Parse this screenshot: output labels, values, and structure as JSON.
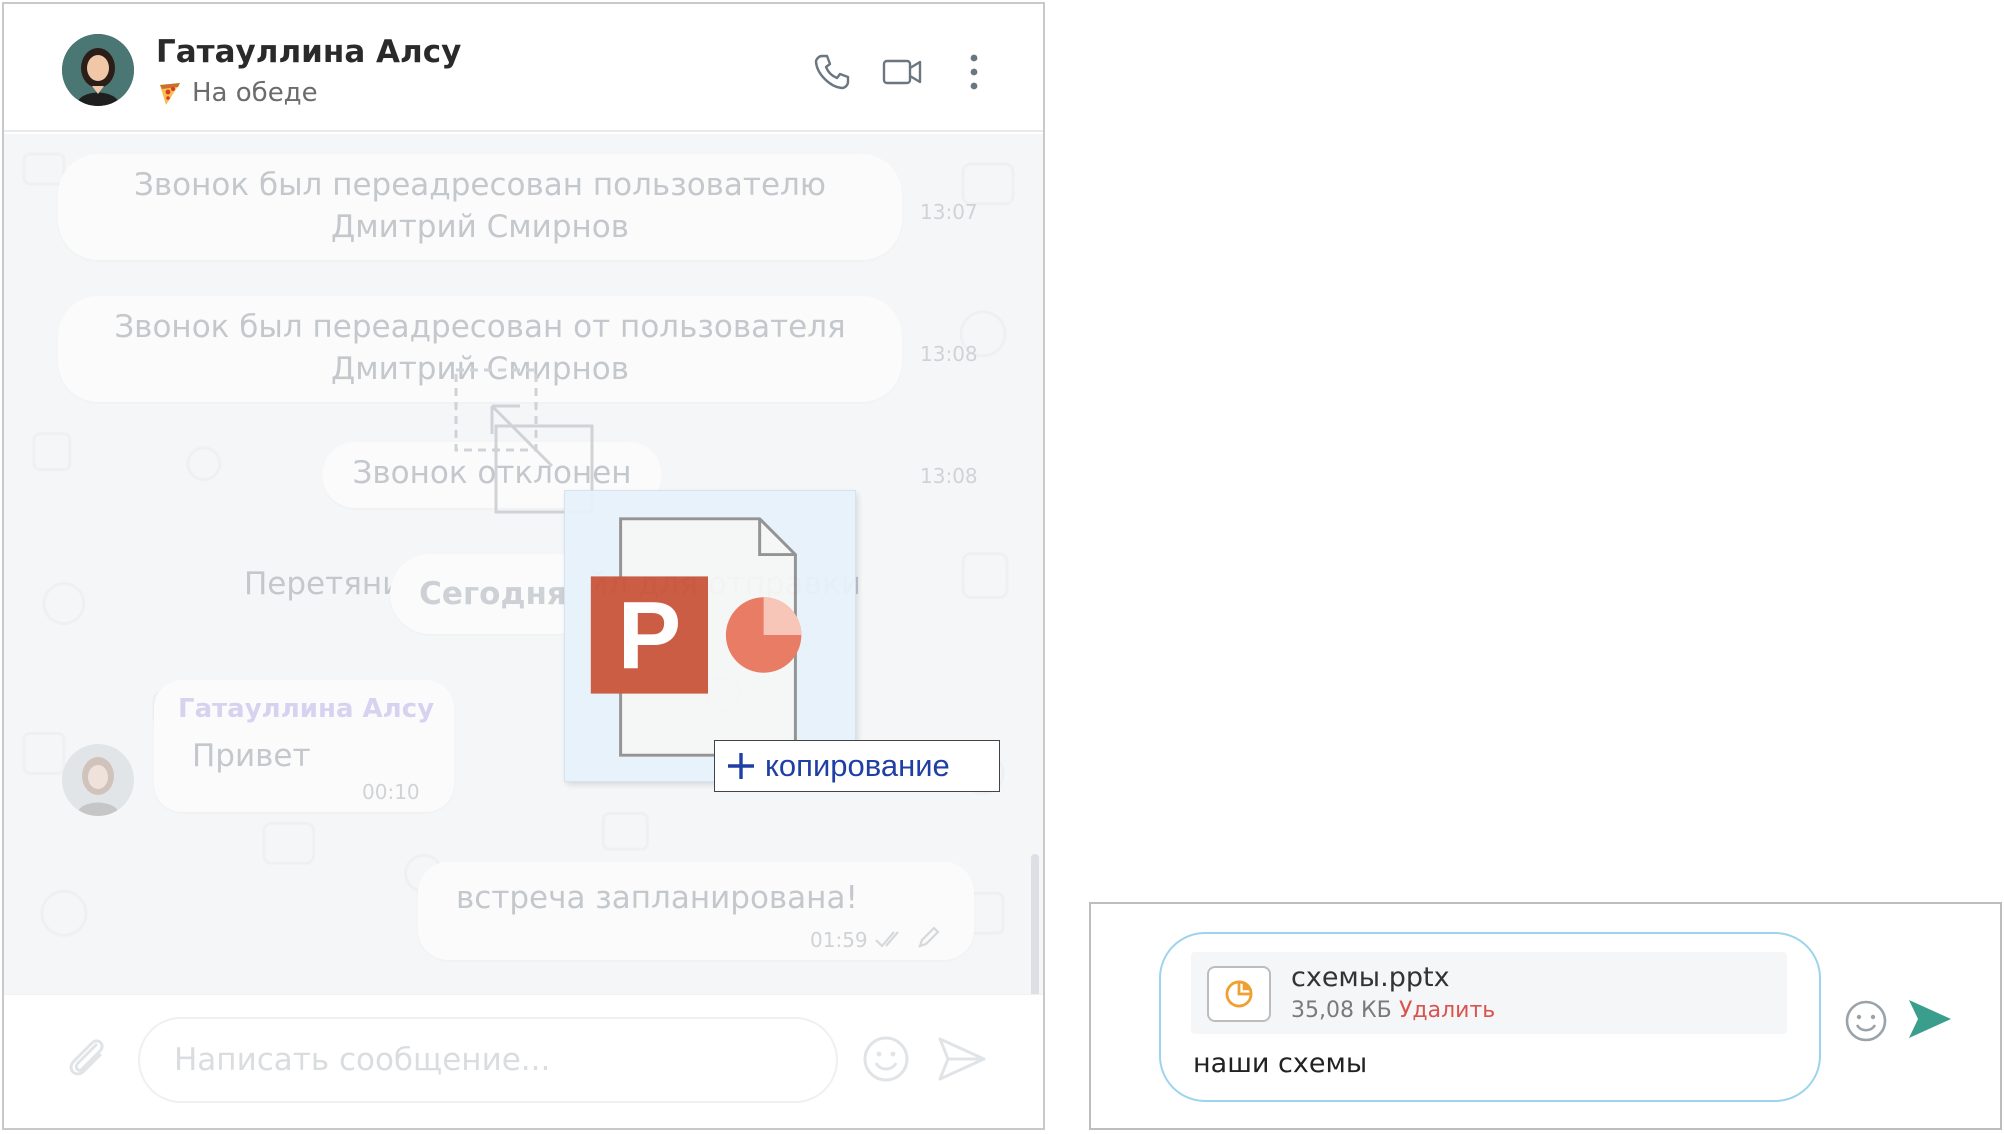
{
  "header": {
    "contact_name": "Гатауллина Алсу",
    "status_emoji": "pizza-icon",
    "status_text": "На обеде",
    "icons": [
      "phone-icon",
      "video-camera-icon",
      "more-vertical-icon"
    ]
  },
  "messages": [
    {
      "type": "system",
      "text": "Звонок был переадресован пользователю Дмитрий Смирнов",
      "time": "13:07"
    },
    {
      "type": "system",
      "text": "Звонок был переадресован от пользователя Дмитрий Смирнов",
      "time": "13:08"
    },
    {
      "type": "system",
      "text": "Звонок отклонен",
      "time": "13:08"
    },
    {
      "type": "date",
      "text": "Сегодня"
    },
    {
      "type": "incoming",
      "sender": "Гатауллина Алсу",
      "text": "Привет",
      "time": "00:10"
    },
    {
      "type": "outgoing",
      "text": "встреча запланирована!",
      "time": "01:59"
    }
  ],
  "dropzone": {
    "hint": "Перетяните сюда файл для отправки",
    "drag_badge": "копирование",
    "drag_file_icon": "powerpoint-file-icon"
  },
  "footer": {
    "placeholder": "Написать сообщение...",
    "icons": [
      "paperclip-icon",
      "emoji-icon",
      "send-icon"
    ]
  },
  "composer": {
    "attachment": {
      "name": "схемы.pptx",
      "size": "35,08 КБ",
      "delete_label": "Удалить",
      "icon": "presentation-file-icon"
    },
    "text": "наши схемы",
    "icons": [
      "emoji-icon",
      "send-icon"
    ],
    "colors": {
      "border": "#9bd4ec",
      "send": "#3a9e8c",
      "delete": "#d9534f",
      "file_icon": "#f0a030"
    }
  }
}
